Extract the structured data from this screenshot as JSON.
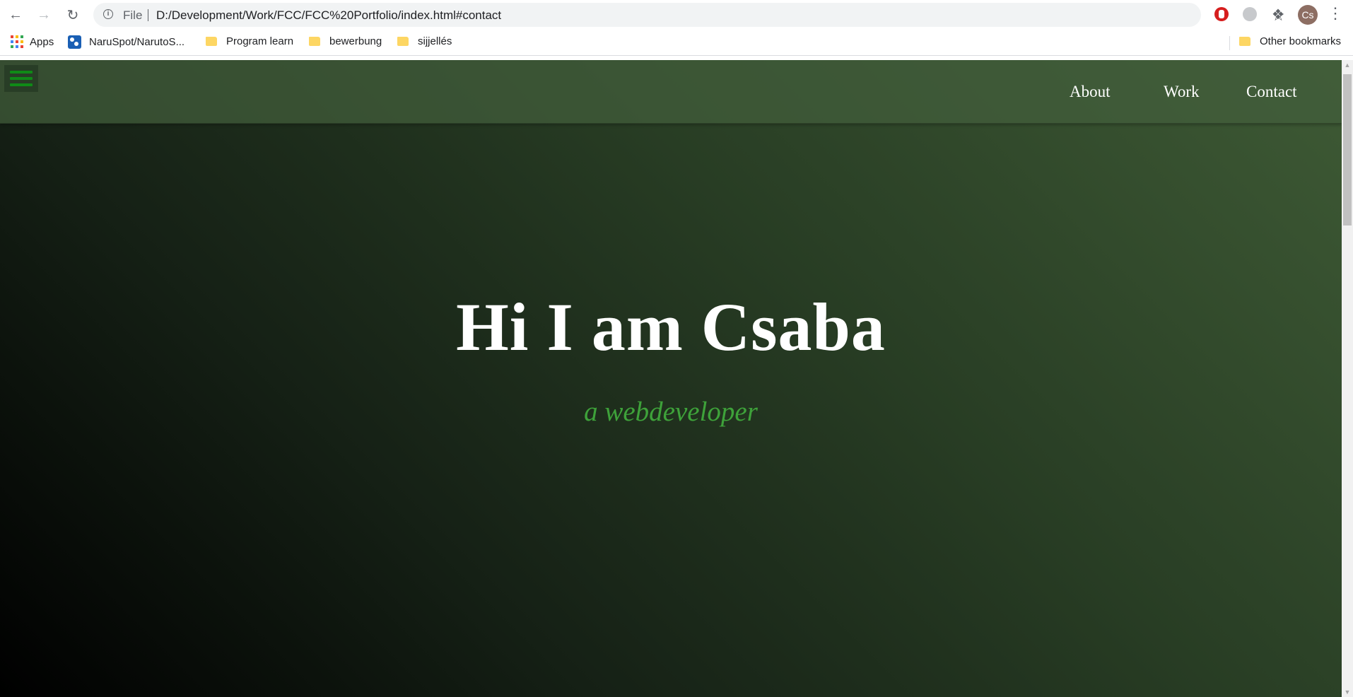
{
  "browser": {
    "scheme_label": "File",
    "url": "D:/Development/Work/FCC/FCC%20Portfolio/index.html#contact",
    "profile_initials": "Cs"
  },
  "bookmarks": {
    "items": [
      {
        "label": "Apps",
        "icon": "apps-grid-icon"
      },
      {
        "label": "NaruSpot/NarutoS...",
        "icon": "site-favicon"
      },
      {
        "label": "Program learn",
        "icon": "folder-icon"
      },
      {
        "label": "bewerbung",
        "icon": "folder-icon"
      },
      {
        "label": "sijjellés",
        "icon": "folder-icon"
      }
    ],
    "other_label": "Other bookmarks"
  },
  "site": {
    "nav": {
      "links": [
        "About",
        "Work",
        "Contact"
      ]
    },
    "hero": {
      "title": "Hi I am Csaba",
      "subtitle": "a webdeveloper"
    }
  },
  "colors": {
    "accent_green": "#3ea23a",
    "hamburger_green": "#0f8a17",
    "nav_bg": "#425e3c"
  }
}
